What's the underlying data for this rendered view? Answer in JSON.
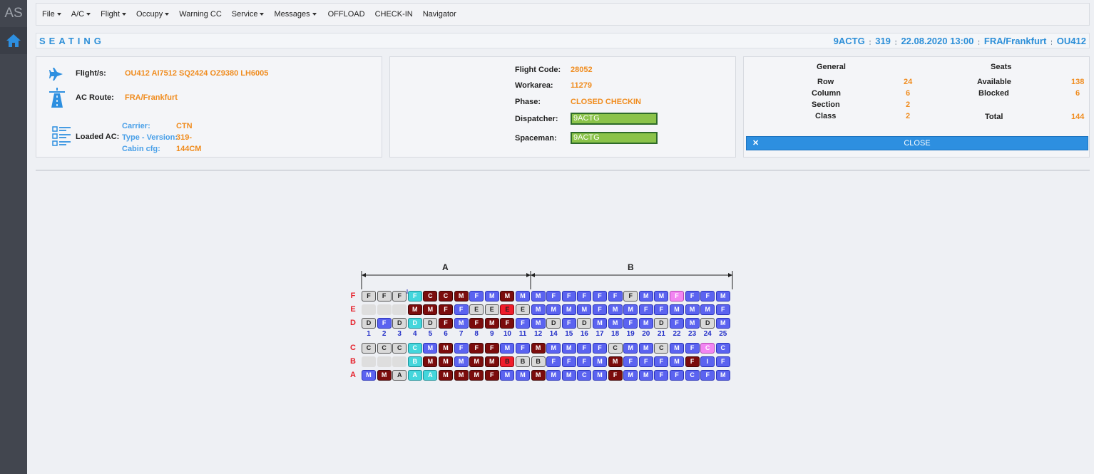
{
  "app": {
    "logo": "AS"
  },
  "menu": [
    {
      "label": "File",
      "dropdown": true
    },
    {
      "label": "A/C",
      "dropdown": true
    },
    {
      "label": "Flight",
      "dropdown": true
    },
    {
      "label": "Occupy",
      "dropdown": true
    },
    {
      "label": "Warning CC",
      "dropdown": false
    },
    {
      "label": "Service",
      "dropdown": true
    },
    {
      "label": "Messages",
      "dropdown": true
    },
    {
      "label": "OFFLOAD",
      "dropdown": false
    },
    {
      "label": "CHECK-IN",
      "dropdown": false
    },
    {
      "label": "Navigator",
      "dropdown": false
    }
  ],
  "titlebar": {
    "title": "SEATING",
    "registration": "9ACTG",
    "aircraft": "319",
    "datetime": "22.08.2020 13:00",
    "station": "FRA/Frankfurt",
    "flight": "OU412"
  },
  "flight_panel": {
    "flights_label": "Flight/s:",
    "flights_value": "OU412 AI7512 SQ2424 OZ9380 LH6005",
    "route_label": "AC Route:",
    "route_value": "FRA/Frankfurt",
    "loaded_label": "Loaded AC:",
    "carrier_label": "Carrier:",
    "carrier_value": "CTN",
    "type_label": "Type - Version:",
    "type_value": "319-",
    "cabin_label": "Cabin cfg:",
    "cabin_value": "144CM"
  },
  "checkin_panel": {
    "flight_code_label": "Flight Code:",
    "flight_code_value": "28052",
    "workarea_label": "Workarea:",
    "workarea_value": "11279",
    "phase_label": "Phase:",
    "phase_value": "CLOSED CHECKIN",
    "dispatcher_label": "Dispatcher:",
    "dispatcher_value": "9ACTG",
    "spaceman_label": "Spaceman:",
    "spaceman_value": "9ACTG"
  },
  "stats_panel": {
    "general_header": "General",
    "seats_header": "Seats",
    "row_label": "Row",
    "row_value": "24",
    "column_label": "Column",
    "column_value": "6",
    "section_label": "Section",
    "section_value": "2",
    "class_label": "Class",
    "class_value": "2",
    "available_label": "Available",
    "available_value": "138",
    "blocked_label": "Blocked",
    "blocked_value": "6",
    "total_label": "Total",
    "total_value": "144",
    "close_label": "CLOSE"
  },
  "seatmap": {
    "sections": [
      "A",
      "B"
    ],
    "columns": [
      "1",
      "2",
      "3",
      "4",
      "5",
      "6",
      "7",
      "8",
      "9",
      "10",
      "11",
      "12",
      "14",
      "15",
      "16",
      "17",
      "18",
      "19",
      "20",
      "21",
      "22",
      "23",
      "24",
      "25"
    ],
    "rows": [
      {
        "letter": "F",
        "seats": [
          "F",
          "F",
          "F",
          "F",
          "C",
          "C",
          "M",
          "F",
          "M",
          "M",
          "M",
          "M",
          "F",
          "F",
          "F",
          "F",
          "F",
          "F",
          "M",
          "M",
          "F",
          "F",
          "F",
          "M"
        ],
        "colors": [
          "g",
          "g",
          "g",
          "c",
          "d",
          "d",
          "d",
          "b",
          "b",
          "d",
          "b",
          "b",
          "b",
          "b",
          "b",
          "b",
          "b",
          "g",
          "b",
          "b",
          "p",
          "b",
          "b",
          "b"
        ]
      },
      {
        "letter": "E",
        "seats": [
          "",
          "",
          "",
          "M",
          "M",
          "F",
          "F",
          "E",
          "E",
          "E",
          "E",
          "M",
          "M",
          "M",
          "M",
          "F",
          "M",
          "M",
          "F",
          "F",
          "M",
          "M",
          "M",
          "F"
        ],
        "colors": [
          "x",
          "x",
          "x",
          "d",
          "d",
          "d",
          "b",
          "g",
          "g",
          "r",
          "g",
          "b",
          "b",
          "b",
          "b",
          "b",
          "b",
          "b",
          "b",
          "b",
          "b",
          "b",
          "b",
          "b"
        ]
      },
      {
        "letter": "D",
        "seats": [
          "D",
          "F",
          "D",
          "D",
          "D",
          "F",
          "M",
          "F",
          "M",
          "F",
          "F",
          "M",
          "D",
          "F",
          "D",
          "M",
          "M",
          "F",
          "M",
          "D",
          "F",
          "M",
          "D",
          "M"
        ],
        "colors": [
          "g",
          "b",
          "g",
          "c",
          "g",
          "d",
          "b",
          "d",
          "d",
          "d",
          "b",
          "b",
          "g",
          "b",
          "g",
          "b",
          "b",
          "b",
          "b",
          "g",
          "b",
          "b",
          "g",
          "b"
        ]
      },
      {
        "letter": "C",
        "seats": [
          "C",
          "C",
          "C",
          "C",
          "M",
          "M",
          "F",
          "F",
          "F",
          "M",
          "F",
          "M",
          "M",
          "M",
          "F",
          "F",
          "C",
          "M",
          "M",
          "C",
          "M",
          "F",
          "C",
          "C"
        ],
        "colors": [
          "g",
          "g",
          "g",
          "c",
          "b",
          "d",
          "b",
          "d",
          "d",
          "b",
          "b",
          "d",
          "b",
          "b",
          "b",
          "b",
          "g",
          "b",
          "b",
          "g",
          "b",
          "b",
          "p",
          "b"
        ]
      },
      {
        "letter": "B",
        "seats": [
          "",
          "",
          "",
          "B",
          "M",
          "M",
          "M",
          "M",
          "M",
          "B",
          "B",
          "B",
          "F",
          "F",
          "F",
          "M",
          "M",
          "F",
          "F",
          "F",
          "M",
          "F",
          "I",
          "F"
        ],
        "colors": [
          "x",
          "x",
          "x",
          "c",
          "d",
          "d",
          "b",
          "d",
          "d",
          "r",
          "g",
          "g",
          "b",
          "b",
          "b",
          "b",
          "d",
          "b",
          "b",
          "b",
          "b",
          "d",
          "b",
          "b"
        ]
      },
      {
        "letter": "A",
        "seats": [
          "M",
          "M",
          "A",
          "A",
          "A",
          "M",
          "M",
          "M",
          "F",
          "M",
          "M",
          "M",
          "M",
          "M",
          "C",
          "M",
          "F",
          "M",
          "M",
          "F",
          "F",
          "C",
          "F",
          "M"
        ],
        "colors": [
          "b",
          "d",
          "g",
          "c",
          "c",
          "d",
          "d",
          "d",
          "d",
          "b",
          "b",
          "d",
          "b",
          "b",
          "b",
          "b",
          "d",
          "b",
          "b",
          "b",
          "b",
          "b",
          "b",
          "b"
        ]
      }
    ],
    "palette": {
      "b": {
        "bg": "#5b63f0",
        "fg": "#ffffff",
        "border": "#2a33b8"
      },
      "d": {
        "bg": "#7b0c0c",
        "fg": "#ffffff",
        "border": "#3f0606"
      },
      "g": {
        "bg": "#d9d9d9",
        "fg": "#222222",
        "border": "#555555"
      },
      "c": {
        "bg": "#44d6dc",
        "fg": "#ffffff",
        "border": "#1d8f96"
      },
      "r": {
        "bg": "#f01c2a",
        "fg": "#222222",
        "border": "#8a0a10"
      },
      "p": {
        "bg": "#f285f2",
        "fg": "#ffffff",
        "border": "#b24ab2"
      },
      "x": {
        "bg": "#dedede",
        "fg": "#dedede",
        "border": "#dedede"
      }
    }
  }
}
